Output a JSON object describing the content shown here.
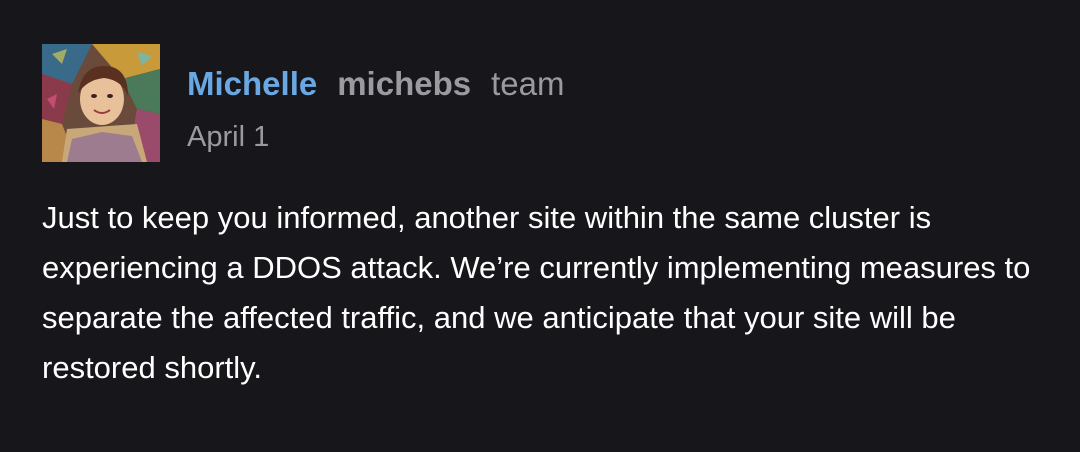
{
  "post": {
    "author": {
      "display_name": "Michelle",
      "username": "michebs",
      "title": "team",
      "avatar_icon": "user-avatar-photo"
    },
    "date": "April 1",
    "body": "Just to keep you informed, another site within the same cluster is experiencing a DDOS attack. We’re currently implementing measures to separate the affected traffic, and we anticipate that your site will be restored shortly."
  },
  "colors": {
    "background": "#17161b",
    "display_name": "#6aa8e3",
    "secondary_text": "#9a9aa0",
    "body_text": "#ffffff"
  }
}
